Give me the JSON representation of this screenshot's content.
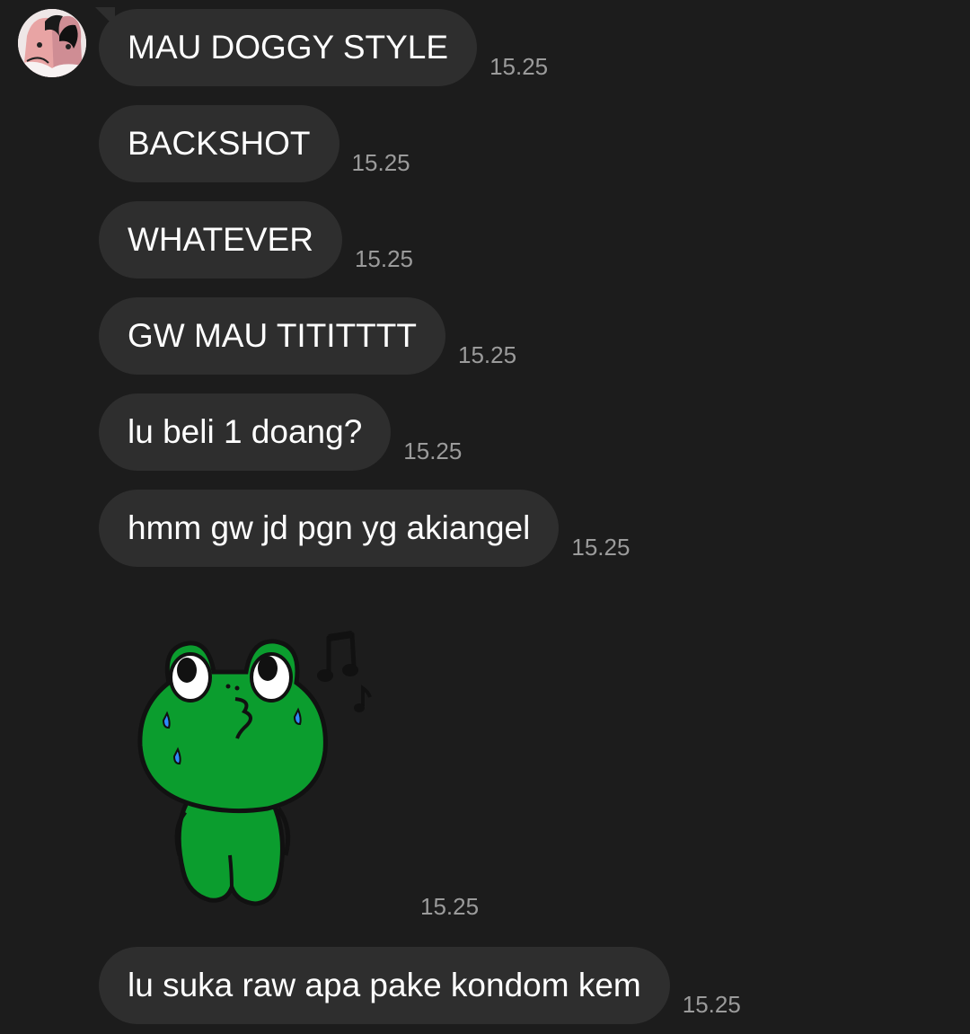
{
  "conversation": {
    "avatar_icon": "profile-avatar-anime",
    "messages": [
      {
        "text": "MAU DOGGY STYLE",
        "time": "15.25"
      },
      {
        "text": "BACKSHOT",
        "time": "15.25"
      },
      {
        "text": "WHATEVER",
        "time": "15.25"
      },
      {
        "text": "GW MAU TITITTTT",
        "time": "15.25"
      },
      {
        "text": "lu beli 1 doang?",
        "time": "15.25"
      },
      {
        "text": "hmm gw jd pgn yg akiangel",
        "time": "15.25"
      },
      {
        "sticker": "green-frog-whistling-sticker",
        "time": "15.25"
      },
      {
        "text": "lu suka raw apa pake kondom kem",
        "time": "15.25"
      }
    ]
  },
  "colors": {
    "background": "#1c1c1c",
    "bubble": "#2e2e2e",
    "text": "#ffffff",
    "timestamp": "#9b9b9b",
    "frog_green": "#0b9d2e"
  }
}
